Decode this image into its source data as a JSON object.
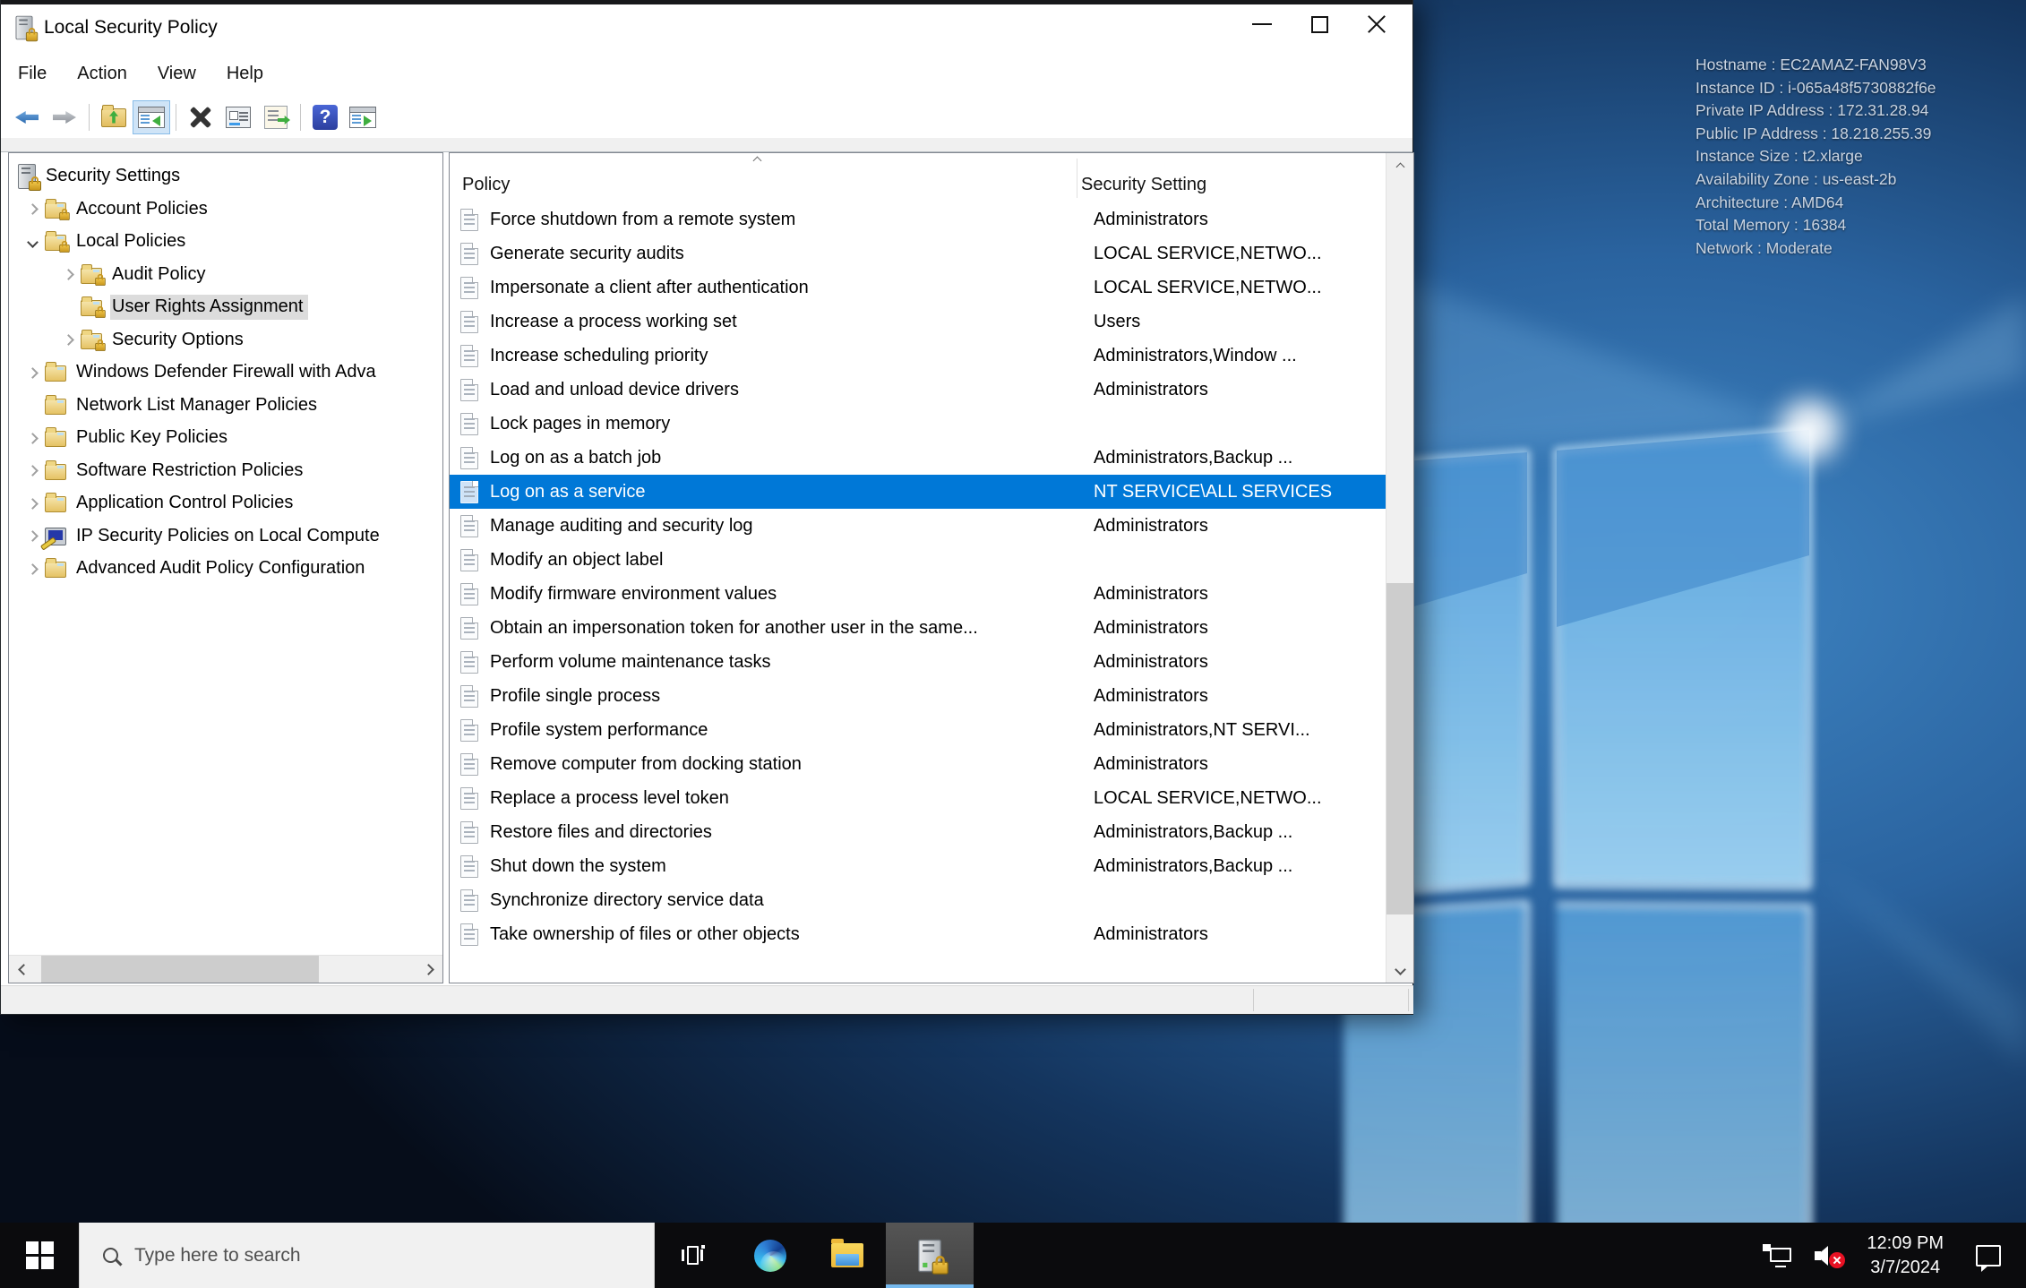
{
  "window": {
    "title": "Local Security Policy",
    "menu": {
      "items": [
        "File",
        "Action",
        "View",
        "Help"
      ]
    },
    "toolbar": {
      "help_glyph": "?",
      "buttons": [
        "back",
        "forward",
        "up-one-level",
        "show-console-tree",
        "delete",
        "properties",
        "export-list",
        "help",
        "new-window"
      ],
      "active_button": "show-console-tree"
    },
    "tree": {
      "items": [
        {
          "label": "Security Settings",
          "level": 0,
          "icon": "security-root",
          "expander": "none",
          "selected": false
        },
        {
          "label": "Account Policies",
          "level": 1,
          "icon": "folder-lock",
          "expander": "collapsed",
          "selected": false
        },
        {
          "label": "Local Policies",
          "level": 1,
          "icon": "folder-lock",
          "expander": "expanded",
          "selected": false
        },
        {
          "label": "Audit Policy",
          "level": 2,
          "icon": "folder-lock",
          "expander": "collapsed",
          "selected": false
        },
        {
          "label": "User Rights Assignment",
          "level": 2,
          "icon": "folder-lock",
          "expander": "none",
          "selected": true
        },
        {
          "label": "Security Options",
          "level": 2,
          "icon": "folder-lock",
          "expander": "collapsed",
          "selected": false
        },
        {
          "label": "Windows Defender Firewall with Adva",
          "level": 1,
          "icon": "folder",
          "expander": "collapsed",
          "selected": false
        },
        {
          "label": "Network List Manager Policies",
          "level": 1,
          "icon": "folder",
          "expander": "none",
          "selected": false
        },
        {
          "label": "Public Key Policies",
          "level": 1,
          "icon": "folder",
          "expander": "collapsed",
          "selected": false
        },
        {
          "label": "Software Restriction Policies",
          "level": 1,
          "icon": "folder",
          "expander": "collapsed",
          "selected": false
        },
        {
          "label": "Application Control Policies",
          "level": 1,
          "icon": "folder",
          "expander": "collapsed",
          "selected": false
        },
        {
          "label": "IP Security Policies on Local Compute",
          "level": 1,
          "icon": "ipsec",
          "expander": "collapsed",
          "selected": false
        },
        {
          "label": "Advanced Audit Policy Configuration",
          "level": 1,
          "icon": "folder",
          "expander": "collapsed",
          "selected": false
        }
      ]
    },
    "list": {
      "columns": [
        "Policy",
        "Security Setting"
      ],
      "rows": [
        {
          "policy": "Force shutdown from a remote system",
          "setting": "Administrators",
          "selected": false
        },
        {
          "policy": "Generate security audits",
          "setting": "LOCAL SERVICE,NETWO...",
          "selected": false
        },
        {
          "policy": "Impersonate a client after authentication",
          "setting": "LOCAL SERVICE,NETWO...",
          "selected": false
        },
        {
          "policy": "Increase a process working set",
          "setting": "Users",
          "selected": false
        },
        {
          "policy": "Increase scheduling priority",
          "setting": "Administrators,Window ...",
          "selected": false
        },
        {
          "policy": "Load and unload device drivers",
          "setting": "Administrators",
          "selected": false
        },
        {
          "policy": "Lock pages in memory",
          "setting": "",
          "selected": false
        },
        {
          "policy": "Log on as a batch job",
          "setting": "Administrators,Backup ...",
          "selected": false
        },
        {
          "policy": "Log on as a service",
          "setting": "NT SERVICE\\ALL SERVICES",
          "selected": true
        },
        {
          "policy": "Manage auditing and security log",
          "setting": "Administrators",
          "selected": false
        },
        {
          "policy": "Modify an object label",
          "setting": "",
          "selected": false
        },
        {
          "policy": "Modify firmware environment values",
          "setting": "Administrators",
          "selected": false
        },
        {
          "policy": "Obtain an impersonation token for another user in the same...",
          "setting": "Administrators",
          "selected": false
        },
        {
          "policy": "Perform volume maintenance tasks",
          "setting": "Administrators",
          "selected": false
        },
        {
          "policy": "Profile single process",
          "setting": "Administrators",
          "selected": false
        },
        {
          "policy": "Profile system performance",
          "setting": "Administrators,NT SERVI...",
          "selected": false
        },
        {
          "policy": "Remove computer from docking station",
          "setting": "Administrators",
          "selected": false
        },
        {
          "policy": "Replace a process level token",
          "setting": "LOCAL SERVICE,NETWO...",
          "selected": false
        },
        {
          "policy": "Restore files and directories",
          "setting": "Administrators,Backup ...",
          "selected": false
        },
        {
          "policy": "Shut down the system",
          "setting": "Administrators,Backup ...",
          "selected": false
        },
        {
          "policy": "Synchronize directory service data",
          "setting": "",
          "selected": false
        },
        {
          "policy": "Take ownership of files or other objects",
          "setting": "Administrators",
          "selected": false
        }
      ]
    }
  },
  "desktop": {
    "info_lines": [
      "Hostname : EC2AMAZ-FAN98V3",
      "Instance ID : i-065a48f5730882f6e",
      "Private IP Address : 172.31.28.94",
      "Public IP Address : 18.218.255.39",
      "Instance Size : t2.xlarge",
      "Availability Zone : us-east-2b",
      "Architecture : AMD64",
      "Total Memory : 16384",
      "Network : Moderate"
    ]
  },
  "taskbar": {
    "search_placeholder": "Type here to search",
    "clock": {
      "time": "12:09 PM",
      "date": "3/7/2024"
    }
  },
  "colors": {
    "selection_blue": "#0078d7",
    "tree_selection_gray": "#dcdcdc",
    "taskbar_bg": "#0b0b0d",
    "active_app_underline": "#76b9ed",
    "status_bg": "#f0f0f0"
  }
}
